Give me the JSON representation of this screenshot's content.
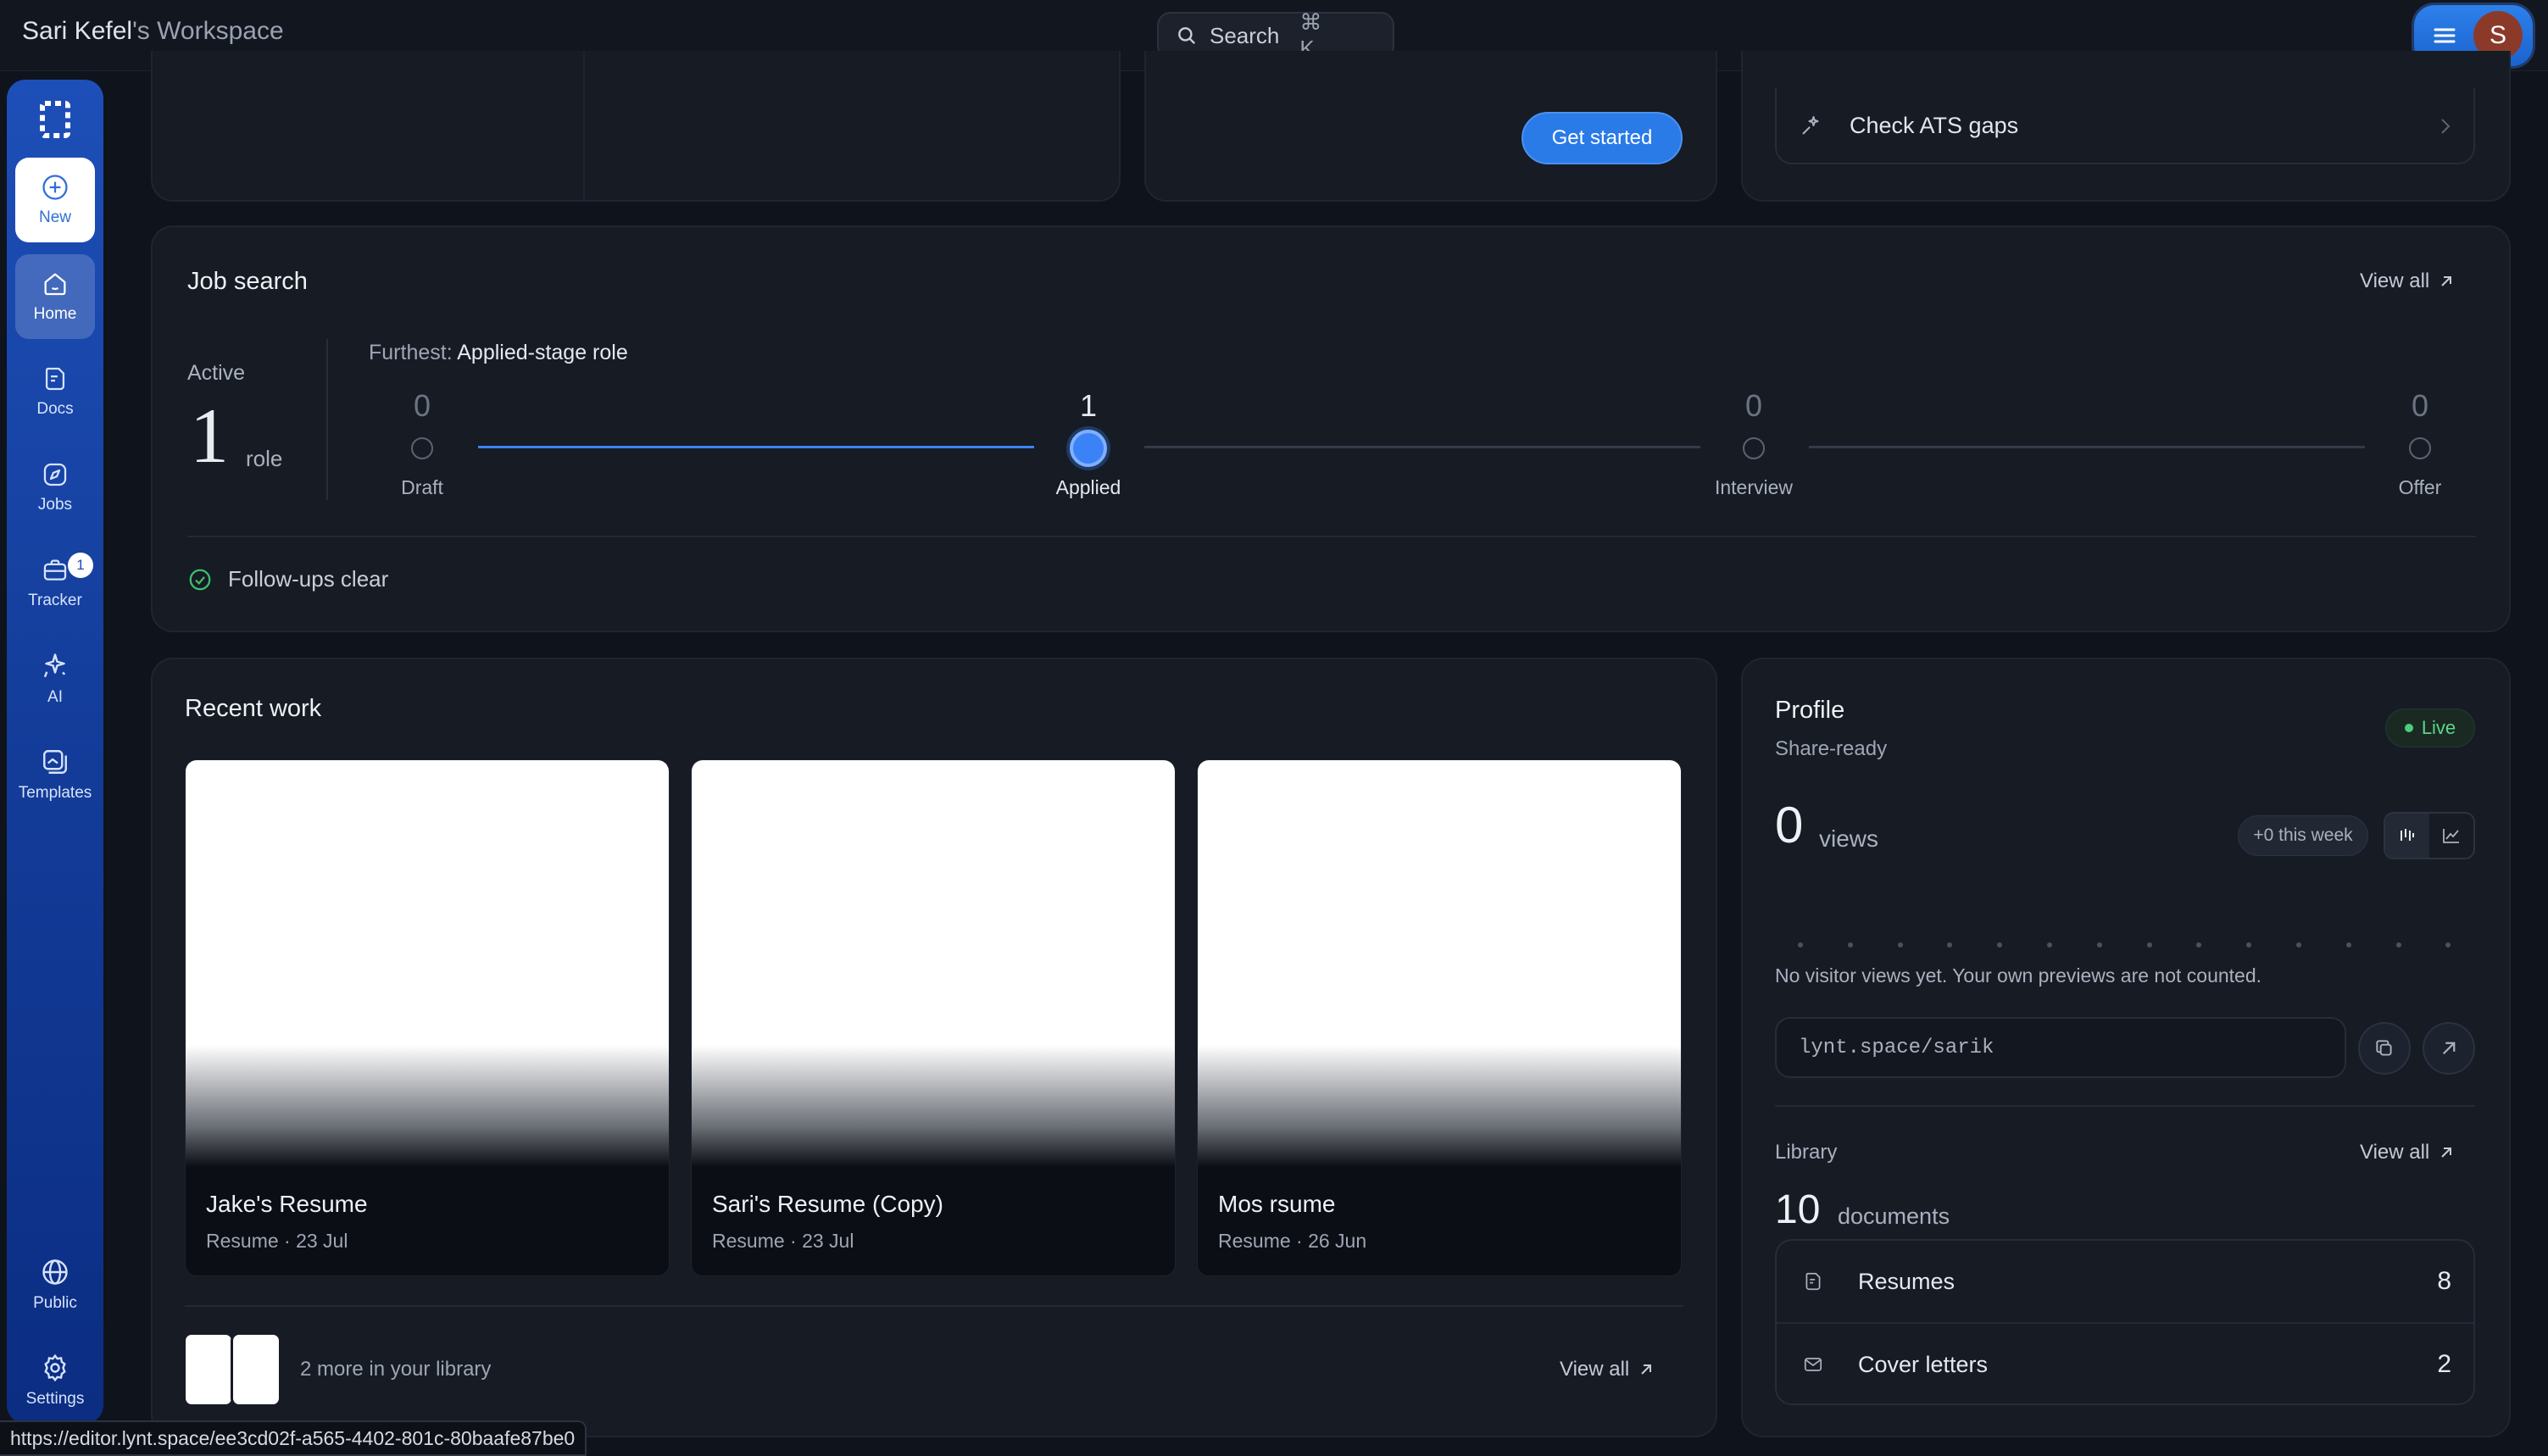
{
  "header": {
    "workspace_owner": "Sari Kefel",
    "workspace_suffix": "'s Workspace",
    "search_label": "Search",
    "search_shortcut": "⌘ K",
    "avatar_initial": "S"
  },
  "sidebar": {
    "items": [
      {
        "label": "New",
        "icon": "plus-circle-icon"
      },
      {
        "label": "Home",
        "icon": "home-icon"
      },
      {
        "label": "Docs",
        "icon": "document-icon"
      },
      {
        "label": "Jobs",
        "icon": "compass-icon"
      },
      {
        "label": "Tracker",
        "icon": "briefcase-icon",
        "badge": "1"
      },
      {
        "label": "AI",
        "icon": "sparkle-icon"
      },
      {
        "label": "Templates",
        "icon": "templates-icon"
      },
      {
        "label": "Public",
        "icon": "globe-icon"
      },
      {
        "label": "Settings",
        "icon": "gear-icon"
      }
    ]
  },
  "top_cards": {
    "get_started_label": "Get started",
    "ats_label": "Check ATS gaps"
  },
  "job_search": {
    "title": "Job search",
    "view_all": "View all",
    "active_label": "Active",
    "active_count": "1",
    "active_unit": "role",
    "furthest_label": "Furthest:",
    "furthest_value": "Applied-stage role",
    "stages": [
      {
        "label": "Draft",
        "count": "0"
      },
      {
        "label": "Applied",
        "count": "1"
      },
      {
        "label": "Interview",
        "count": "0"
      },
      {
        "label": "Offer",
        "count": "0"
      }
    ],
    "current_stage": "Applied",
    "followups": "Follow-ups clear"
  },
  "recent_work": {
    "title": "Recent work",
    "docs": [
      {
        "name": "Jake's Resume",
        "meta": "Resume · 23 Jul"
      },
      {
        "name": "Sari's Resume (Copy)",
        "meta": "Resume · 23 Jul"
      },
      {
        "name": "Mos rsume",
        "meta": "Resume · 26 Jun"
      }
    ],
    "more_text": "2 more in your library",
    "view_all": "View all"
  },
  "profile": {
    "title": "Profile",
    "subtitle": "Share-ready",
    "status": "Live",
    "views": "0",
    "views_label": "views",
    "week_delta": "+0 this week",
    "no_views_text": "No visitor views yet. Your own previews are not counted.",
    "url": "lynt.space/sarik",
    "library": {
      "label": "Library",
      "view_all": "View all",
      "count": "10",
      "count_label": "documents",
      "rows": [
        {
          "label": "Resumes",
          "count": "8",
          "icon": "resume-icon"
        },
        {
          "label": "Cover letters",
          "count": "2",
          "icon": "mail-icon"
        }
      ]
    }
  },
  "status_bar": {
    "url": "https://editor.lynt.space/ee3cd02f-a565-4402-801c-80baafe87be0"
  },
  "colors": {
    "accent": "#2a7ae8",
    "background": "#0f131b",
    "card": "#161b24",
    "live_green": "#4ccc7c",
    "sidebar_top": "#1d4fb8",
    "sidebar_bottom": "#0b2d82"
  }
}
